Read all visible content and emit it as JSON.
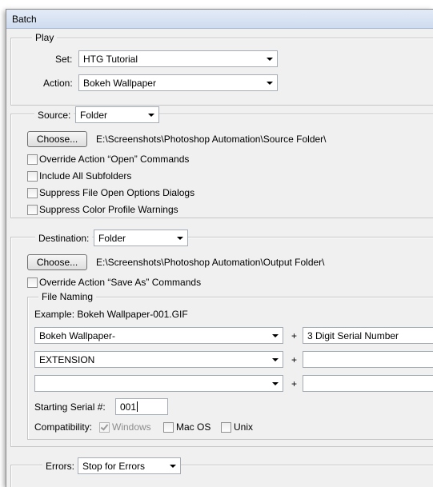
{
  "window": {
    "title": "Batch"
  },
  "play": {
    "legend": "Play",
    "set_label": "Set:",
    "set_value": "HTG Tutorial",
    "action_label": "Action:",
    "action_value": "Bokeh Wallpaper"
  },
  "source": {
    "label": "Source:",
    "value": "Folder",
    "choose_label": "Choose...",
    "path": "E:\\Screenshots\\Photoshop Automation\\Source Folder\\",
    "options": [
      {
        "label": "Override Action “Open” Commands",
        "checked": false
      },
      {
        "label": "Include All Subfolders",
        "checked": false
      },
      {
        "label": "Suppress File Open Options Dialogs",
        "checked": false
      },
      {
        "label": "Suppress Color Profile Warnings",
        "checked": false
      }
    ]
  },
  "destination": {
    "label": "Destination:",
    "value": "Folder",
    "choose_label": "Choose...",
    "path": "E:\\Screenshots\\Photoshop Automation\\Output Folder\\",
    "override_label": "Override Action “Save As” Commands"
  },
  "file_naming": {
    "legend": "File Naming",
    "example": "Example: Bokeh Wallpaper-001.GIF",
    "row1_left": "Bokeh Wallpaper-",
    "row1_right": "3 Digit Serial Number",
    "row2_left": "EXTENSION",
    "row2_right": "",
    "row3_left": "",
    "row3_right": "",
    "plus": "+",
    "serial_label": "Starting Serial #:",
    "serial_value": "001",
    "compat_label": "Compatibility:",
    "compat_windows": "Windows",
    "compat_macos": "Mac OS",
    "compat_unix": "Unix"
  },
  "errors": {
    "label": "Errors:",
    "value": "Stop for Errors"
  }
}
